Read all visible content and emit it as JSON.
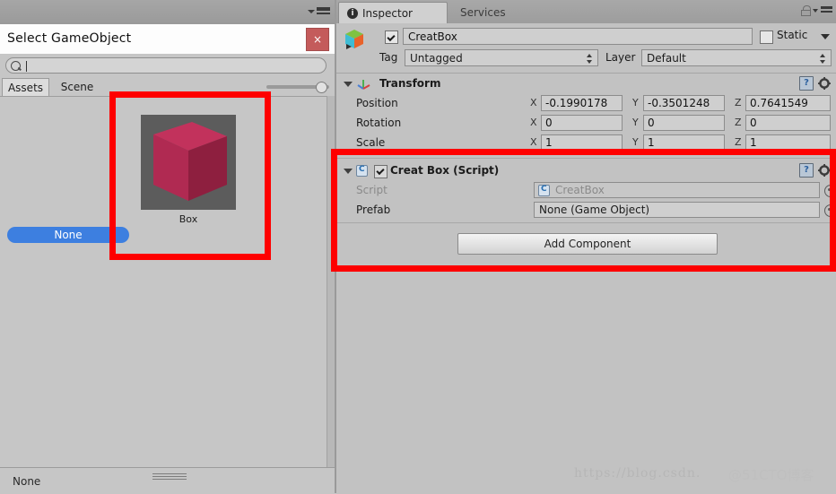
{
  "left_dialog": {
    "topbar": {
      "menu_icon": "hamburger-menu-icon"
    },
    "title": "Select GameObject",
    "close_label": "×",
    "search": {
      "value": "",
      "placeholder": "",
      "icon": "search-icon"
    },
    "tabs": [
      {
        "label": "Assets",
        "selected": true
      },
      {
        "label": "Scene",
        "selected": false
      }
    ],
    "zoom_slider": {
      "value": 100
    },
    "none_item": {
      "label": "None"
    },
    "asset": {
      "label": "Box",
      "thumb": "red-cube-3d-thumbnail"
    },
    "status": {
      "label": "None",
      "grip": "resize-grip-icon"
    }
  },
  "inspector": {
    "tabs": [
      {
        "label": "Inspector",
        "selected": true,
        "icon": "info-icon"
      },
      {
        "label": "Services",
        "selected": false
      }
    ],
    "lock_icon": "lock-icon",
    "menu_icon": "hamburger-menu-icon",
    "gameobject": {
      "icon": "unity-prefab-cube-icon",
      "enabled": true,
      "name": "CreatBox",
      "static_label": "Static",
      "static_checked": false,
      "tag_label": "Tag",
      "tag_value": "Untagged",
      "layer_label": "Layer",
      "layer_value": "Default"
    },
    "transform": {
      "title": "Transform",
      "icon": "transform-gizmo-icon",
      "help_icon": "help-book-icon",
      "gear_icon": "settings-gear-icon",
      "rows": [
        {
          "label": "Position",
          "x": "-0.1990178",
          "y": "-0.3501248",
          "z": "0.7641549"
        },
        {
          "label": "Rotation",
          "x": "0",
          "y": "0",
          "z": "0"
        },
        {
          "label": "Scale",
          "x": "1",
          "y": "1",
          "z": "1"
        }
      ],
      "axis_labels": [
        "X",
        "Y",
        "Z"
      ]
    },
    "script_component": {
      "title": "Creat Box (Script)",
      "icon": "csharp-script-icon",
      "enabled": true,
      "help_icon": "help-book-icon",
      "gear_icon": "settings-gear-icon",
      "fields": [
        {
          "label": "Script",
          "value": "CreatBox",
          "readonly": true,
          "picker": "object-picker-icon"
        },
        {
          "label": "Prefab",
          "value": "None (Game Object)",
          "readonly": false,
          "picker": "object-picker-icon"
        }
      ]
    },
    "add_component_label": "Add Component"
  },
  "watermark": {
    "url": "https://blog.csdn.",
    "brand": "@51CTO博客"
  },
  "colors": {
    "accent_blue": "#3d7fe0",
    "annotation_red": "#fe0000",
    "panel_bg": "#c2c2c2",
    "close_red": "#c45b5b"
  }
}
